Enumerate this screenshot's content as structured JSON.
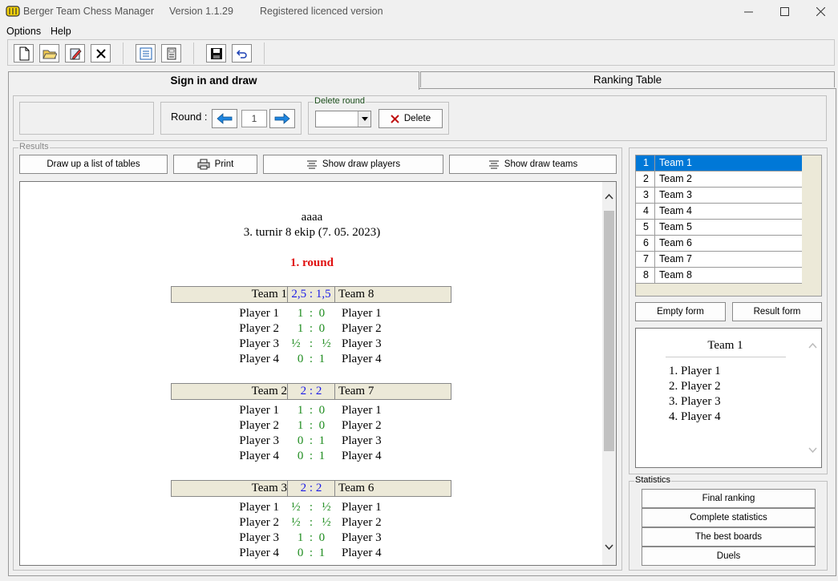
{
  "window": {
    "app_title": "Berger Team Chess Manager",
    "version": "Version 1.1.29",
    "license": "Registered licenced version"
  },
  "menu": [
    "Options",
    "Help"
  ],
  "tabs": [
    "Sign in and draw",
    "Ranking Table"
  ],
  "round": {
    "label": "Round :",
    "value": "1"
  },
  "delete_round": {
    "label": "Delete round",
    "select_value": "",
    "button": "Delete"
  },
  "results": {
    "label": "Results",
    "buttons": {
      "draw_list": "Draw up a list of tables",
      "print": "Print",
      "show_players": "Show draw players",
      "show_teams": "Show draw teams"
    }
  },
  "report": {
    "title": "aaaa",
    "subtitle": "3. turnir 8 ekip (7. 05. 2023)",
    "round_title": "1. round",
    "matches": [
      {
        "home": "Team 1",
        "score": "2,5 : 1,5",
        "away": "Team 8",
        "boards": [
          [
            "Player 1",
            "1  :  0",
            "Player 1"
          ],
          [
            "Player 2",
            "1  :  0",
            "Player 2"
          ],
          [
            "Player 3",
            "½   :   ½",
            "Player 3"
          ],
          [
            "Player 4",
            "0  :  1",
            "Player 4"
          ]
        ]
      },
      {
        "home": "Team 2",
        "score": "2 : 2",
        "away": "Team 7",
        "boards": [
          [
            "Player 1",
            "1  :  0",
            "Player 1"
          ],
          [
            "Player 2",
            "1  :  0",
            "Player 2"
          ],
          [
            "Player 3",
            "0  :  1",
            "Player 3"
          ],
          [
            "Player 4",
            "0  :  1",
            "Player 4"
          ]
        ]
      },
      {
        "home": "Team 3",
        "score": "2 : 2",
        "away": "Team 6",
        "boards": [
          [
            "Player 1",
            "½   :   ½",
            "Player 1"
          ],
          [
            "Player 2",
            "½   :   ½",
            "Player 2"
          ],
          [
            "Player 3",
            "1  :  0",
            "Player 3"
          ],
          [
            "Player 4",
            "0  :  1",
            "Player 4"
          ]
        ]
      }
    ]
  },
  "teams": [
    {
      "num": "1",
      "name": "Team 1",
      "selected": true
    },
    {
      "num": "2",
      "name": "Team 2"
    },
    {
      "num": "3",
      "name": "Team 3"
    },
    {
      "num": "4",
      "name": "Team 4"
    },
    {
      "num": "5",
      "name": "Team 5"
    },
    {
      "num": "6",
      "name": "Team 6"
    },
    {
      "num": "7",
      "name": "Team 7"
    },
    {
      "num": "8",
      "name": "Team 8"
    }
  ],
  "forms": {
    "empty": "Empty form",
    "result": "Result form"
  },
  "detail": {
    "team": "Team 1",
    "players": [
      "1. Player 1",
      "2. Player 2",
      "3. Player 3",
      "4. Player 4"
    ]
  },
  "statistics": {
    "label": "Statistics",
    "buttons": [
      "Final ranking",
      "Complete statistics",
      "The best boards",
      "Duels"
    ]
  },
  "colors": {
    "round_red": "#e01010",
    "score_blue": "#1a1ae6",
    "result_green": "#1e8c1e",
    "selection": "#0078d7",
    "match_bar": "#ece9d8"
  }
}
